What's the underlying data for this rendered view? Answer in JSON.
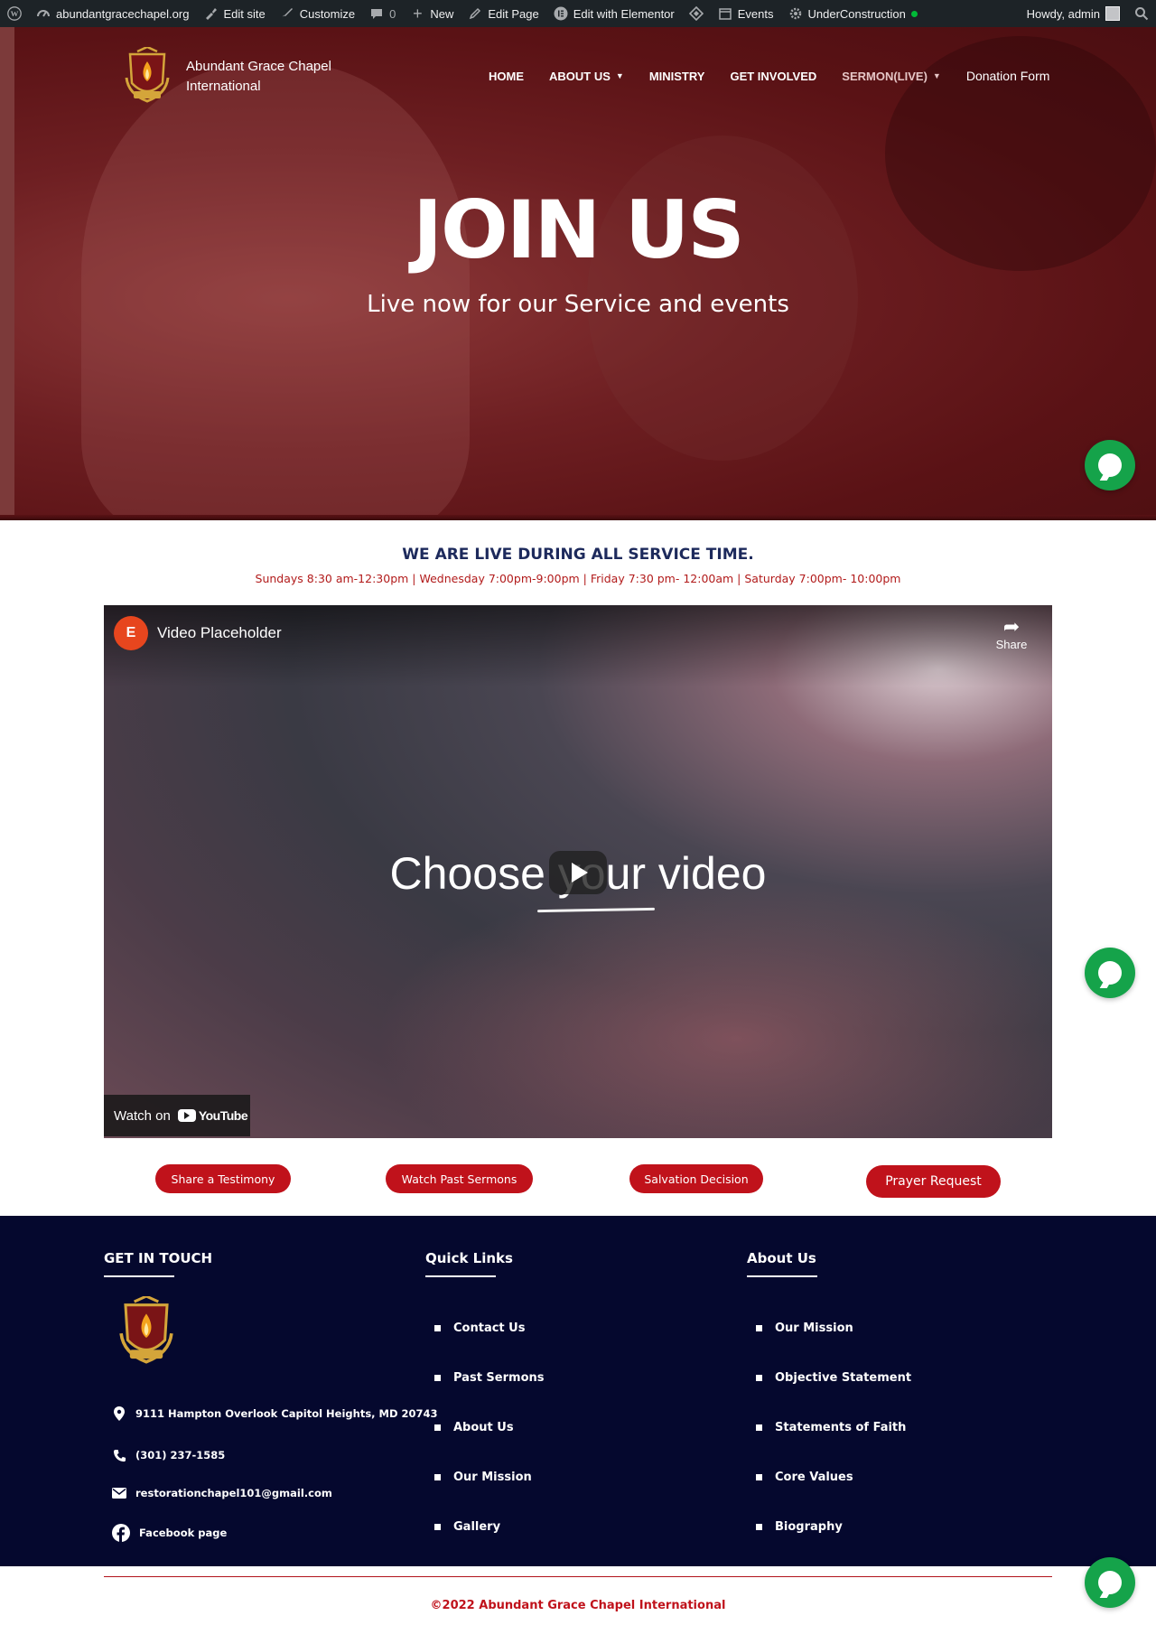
{
  "admin_bar": {
    "site": "abundantgracechapel.org",
    "edit_site": "Edit site",
    "customize": "Customize",
    "comments_count": "0",
    "new": "New",
    "edit_page": "Edit Page",
    "edit_elementor": "Edit with Elementor",
    "events": "Events",
    "under_construction": "UnderConstruction",
    "howdy": "Howdy, admin"
  },
  "brand": {
    "line1": "Abundant Grace Chapel",
    "line2": "International",
    "crest_letters": "A.G.C.I"
  },
  "nav": {
    "home": "HOME",
    "about": "ABOUT US",
    "ministry": "MINISTRY",
    "get_involved": "GET INVOLVED",
    "sermon": "SERMON(LIVE)",
    "donation": "Donation Form"
  },
  "hero": {
    "title": "JOIN US",
    "subtitle": "Live now for our Service and events"
  },
  "live": {
    "title": "WE ARE LIVE DURING ALL SERVICE TIME.",
    "times": "Sundays 8:30 am-12:30pm | Wednesday 7:00pm-9:00pm | Friday 7:30 pm- 12:00am | Saturday 7:00pm- 10:00pm"
  },
  "video": {
    "title": "Video Placeholder",
    "share": "Share",
    "caption": "Choose your video",
    "watch_on": "Watch on",
    "youtube": "YouTube"
  },
  "actions": {
    "testimony": "Share a Testimony",
    "past_sermons": "Watch Past Sermons",
    "salvation": "Salvation Decision",
    "prayer": "Prayer Request"
  },
  "footer": {
    "get_in_touch": "GET IN TOUCH",
    "quick_links_title": "Quick Links",
    "about_title": "About Us",
    "address": "9111 Hampton Overlook Capitol Heights, MD 20743",
    "phone": "(301) 237-1585",
    "email": "restorationchapel101@gmail.com",
    "facebook": "Facebook page",
    "quick_links": [
      "Contact Us",
      "Past Sermons",
      "About Us",
      "Our Mission",
      "Gallery"
    ],
    "about_links": [
      "Our Mission",
      "Objective Statement",
      "Statements of Faith",
      "Core Values",
      "Biography"
    ],
    "copyright": "©2022 Abundant Grace Chapel International"
  },
  "colors": {
    "hero_overlay": "#5a1215",
    "accent_red": "#c0121b",
    "footer_navy": "#05082e",
    "live_title": "#1d2a5c",
    "chat_green": "#15a34a"
  }
}
